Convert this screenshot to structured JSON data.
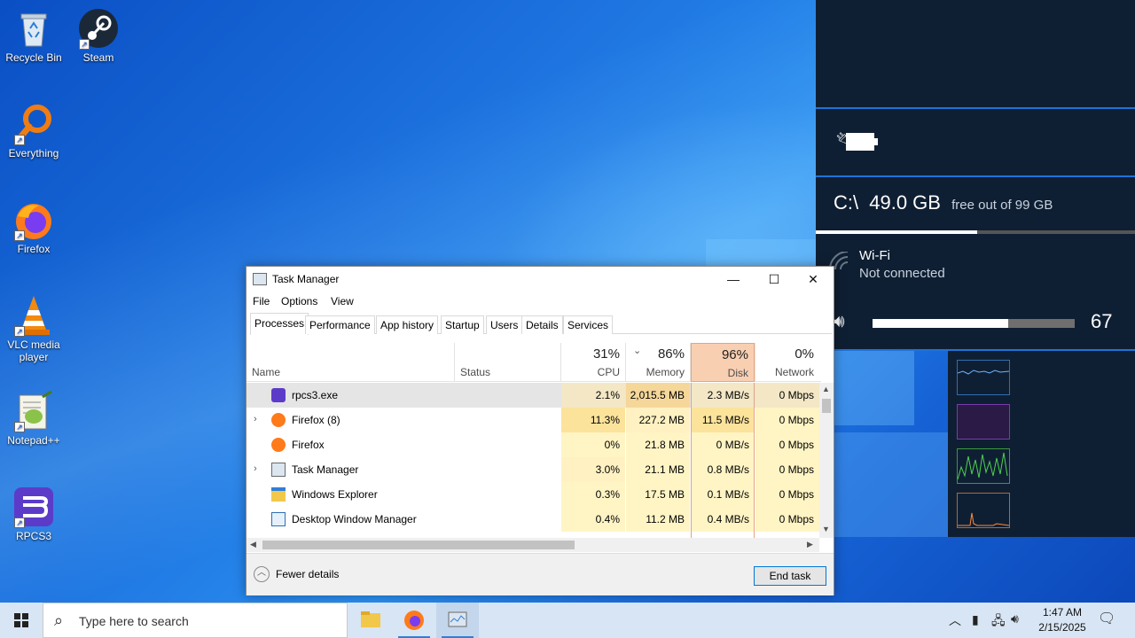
{
  "desktop": {
    "icons": [
      {
        "label": "Recycle Bin"
      },
      {
        "label": "Steam"
      },
      {
        "label": "Everything"
      },
      {
        "label": "Firefox"
      },
      {
        "label": "VLC media player"
      },
      {
        "label": "Notepad++"
      },
      {
        "label": "RPCS3"
      }
    ]
  },
  "side_panel": {
    "drive_letter": "C:\\",
    "drive_free": "49.0 GB",
    "drive_caption": "free out of 99 GB",
    "drive_used_fraction": 0.505,
    "wifi_name": "Wi-Fi",
    "wifi_status": "Not connected",
    "volume": "67",
    "volume_fraction": 0.67
  },
  "task_manager": {
    "title": "Task Manager",
    "menu": [
      "File",
      "Options",
      "View"
    ],
    "tabs": [
      "Processes",
      "Performance",
      "App history",
      "Startup",
      "Users",
      "Details",
      "Services"
    ],
    "active_tab": "Processes",
    "columns": {
      "name": "Name",
      "status": "Status",
      "cpu": {
        "pct": "31%",
        "label": "CPU"
      },
      "memory": {
        "pct": "86%",
        "label": "Memory"
      },
      "disk": {
        "pct": "96%",
        "label": "Disk"
      },
      "network": {
        "pct": "0%",
        "label": "Network"
      }
    },
    "processes": [
      {
        "name": "rpcs3.exe",
        "expandable": false,
        "cpu": "2.1%",
        "memory": "2,015.5 MB",
        "disk": "2.3 MB/s",
        "network": "0 Mbps"
      },
      {
        "name": "Firefox (8)",
        "expandable": true,
        "cpu": "11.3%",
        "memory": "227.2 MB",
        "disk": "11.5 MB/s",
        "network": "0 Mbps"
      },
      {
        "name": "Firefox",
        "expandable": false,
        "cpu": "0%",
        "memory": "21.8 MB",
        "disk": "0 MB/s",
        "network": "0 Mbps"
      },
      {
        "name": "Task Manager",
        "expandable": true,
        "cpu": "3.0%",
        "memory": "21.1 MB",
        "disk": "0.8 MB/s",
        "network": "0 Mbps"
      },
      {
        "name": "Windows Explorer",
        "expandable": false,
        "cpu": "0.3%",
        "memory": "17.5 MB",
        "disk": "0.1 MB/s",
        "network": "0 Mbps"
      },
      {
        "name": "Desktop Window Manager",
        "expandable": false,
        "cpu": "0.4%",
        "memory": "11.2 MB",
        "disk": "0.4 MB/s",
        "network": "0 Mbps"
      }
    ],
    "fewer_details": "Fewer details",
    "end_task": "End task"
  },
  "taskbar": {
    "search_placeholder": "Type here to search",
    "time": "1:47 AM",
    "date": "2/15/2025"
  },
  "colors": {
    "accent": "#0078d7",
    "disk_header": "#f7c9a9",
    "cell_hi": "#fbe39b",
    "cell_lo": "#fff4c4"
  }
}
